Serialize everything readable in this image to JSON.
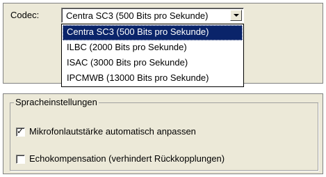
{
  "codec": {
    "label": "Codec:",
    "selected_value": "Centra SC3 (500 Bits pro Sekunde)",
    "options": [
      "Centra SC3 (500 Bits pro Sekunde)",
      "ILBC (2000 Bits pro Sekunde)",
      "ISAC (3000 Bits pro Sekunde)",
      "IPCMWB (13000 Bits pro Sekunde)"
    ],
    "highlighted_index": 0
  },
  "speech_settings": {
    "group_title": "Spracheinstellungen",
    "auto_mic_volume": {
      "label": "Mikrofonlautstärke automatisch anpassen",
      "checked": true
    },
    "echo_compensation": {
      "label": "Echokompensation (verhindert Rückkopplungen)",
      "checked": false
    }
  },
  "colors": {
    "panel_bg": "#ece9d8",
    "selection_bg": "#0a246a",
    "selection_text": "#ffffff"
  },
  "icons": {
    "dropdown_arrow": "chevron-down-icon",
    "checkmark": "checkmark-icon"
  }
}
